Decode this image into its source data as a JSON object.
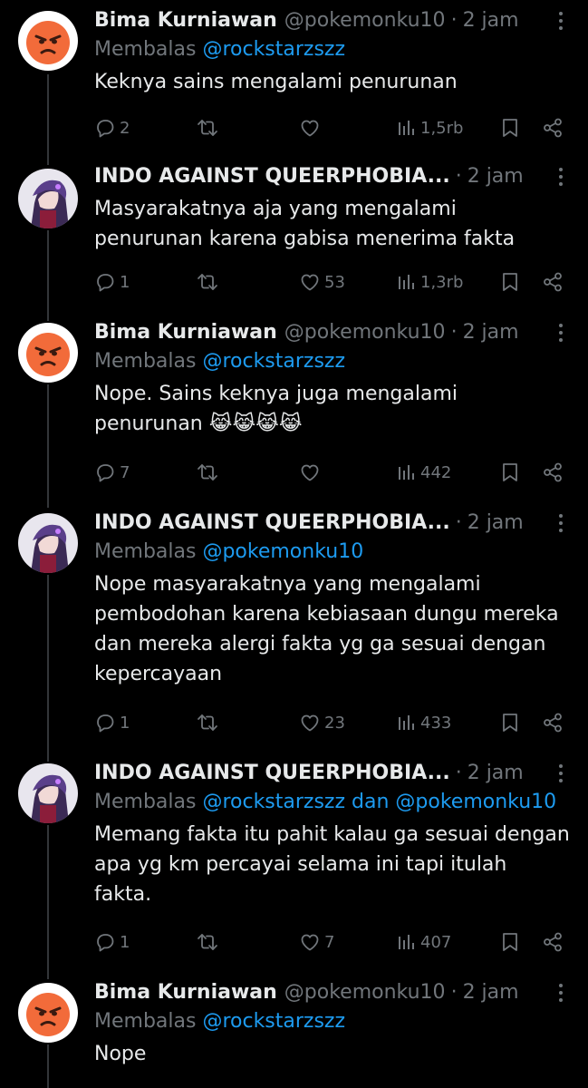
{
  "colors": {
    "background": "#000000",
    "text": "#e7e9ea",
    "muted": "#71767b",
    "link": "#1d9bf0",
    "line": "#333639"
  },
  "tweets": [
    {
      "avatar": "angry-face-avatar",
      "name": "Bima Kurniawan",
      "handle": "@pokemonku10",
      "time": "2 jam",
      "reply_prefix": "Membalas",
      "mention1": "@rockstarzszz",
      "mention_sep": "",
      "mention2": "",
      "text": "Keknya sains mengalami penurunan",
      "replies": "2",
      "retweets": "",
      "likes": "",
      "views": "1,5rb"
    },
    {
      "avatar": "anime-character-avatar",
      "name": "INDO AGAINST QUEERPHOBIA...",
      "handle": "",
      "time": "2 jam",
      "reply_prefix": "",
      "mention1": "",
      "mention_sep": "",
      "mention2": "",
      "text": "Masyarakatnya aja yang mengalami penurunan karena gabisa menerima fakta",
      "replies": "1",
      "retweets": "",
      "likes": "53",
      "views": "1,3rb"
    },
    {
      "avatar": "angry-face-avatar",
      "name": "Bima Kurniawan",
      "handle": "@pokemonku10",
      "time": "2 jam",
      "reply_prefix": "Membalas",
      "mention1": "@rockstarzszz",
      "mention_sep": "",
      "mention2": "",
      "text": "Nope. Sains keknya juga mengalami penurunan 😹😹😹😹",
      "replies": "7",
      "retweets": "",
      "likes": "",
      "views": "442"
    },
    {
      "avatar": "anime-character-avatar",
      "name": "INDO AGAINST QUEERPHOBIA...",
      "handle": "",
      "time": "2 jam",
      "reply_prefix": "Membalas",
      "mention1": "@pokemonku10",
      "mention_sep": "",
      "mention2": "",
      "text": "Nope masyarakatnya yang mengalami pembodohan karena kebiasaan dungu mereka dan mereka alergi fakta yg ga sesuai dengan kepercayaan",
      "replies": "1",
      "retweets": "",
      "likes": "23",
      "views": "433"
    },
    {
      "avatar": "anime-character-avatar",
      "name": "INDO AGAINST QUEERPHOBIA...",
      "handle": "",
      "time": "2 jam",
      "reply_prefix": "Membalas",
      "mention1": "@rockstarzszz",
      "mention_sep": "dan",
      "mention2": "@pokemonku10",
      "text": "Memang fakta itu pahit kalau ga sesuai dengan apa yg km percayai selama ini tapi itulah fakta.",
      "replies": "1",
      "retweets": "",
      "likes": "7",
      "views": "407"
    },
    {
      "avatar": "angry-face-avatar",
      "name": "Bima Kurniawan",
      "handle": "@pokemonku10",
      "time": "2 jam",
      "reply_prefix": "Membalas",
      "mention1": "@rockstarzszz",
      "mention_sep": "",
      "mention2": "",
      "text": "Nope",
      "replies": "",
      "retweets": "",
      "likes": "",
      "views": ""
    }
  ]
}
